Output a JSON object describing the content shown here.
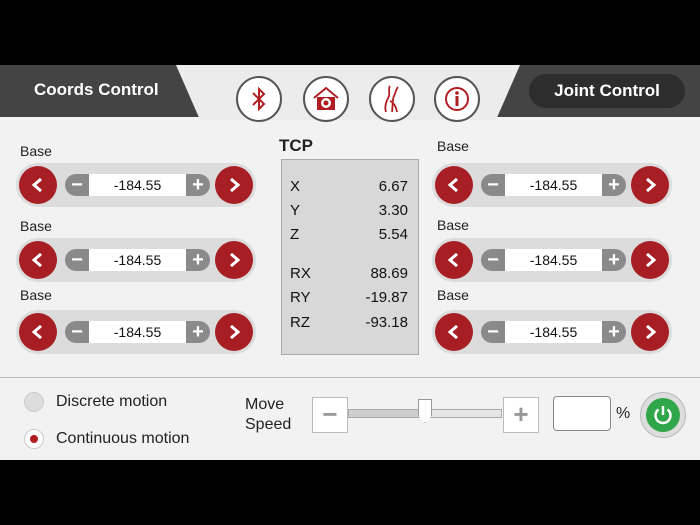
{
  "header": {
    "left_title": "Coords Control",
    "right_button": "Joint Control",
    "icons": [
      "bluetooth-icon",
      "home-target-icon",
      "hand-icon",
      "info-icon"
    ]
  },
  "left_controls": [
    {
      "label": "Base",
      "value": "-184.55"
    },
    {
      "label": "Base",
      "value": "-184.55"
    },
    {
      "label": "Base",
      "value": "-184.55"
    }
  ],
  "right_controls": [
    {
      "label": "Base",
      "value": "-184.55"
    },
    {
      "label": "Base",
      "value": "-184.55"
    },
    {
      "label": "Base",
      "value": "-184.55"
    }
  ],
  "tcp": {
    "title": "TCP",
    "rows": [
      {
        "key": "X",
        "value": "6.67"
      },
      {
        "key": "Y",
        "value": "3.30"
      },
      {
        "key": "Z",
        "value": "5.54"
      },
      {
        "key": "RX",
        "value": "88.69"
      },
      {
        "key": "RY",
        "value": "-19.87"
      },
      {
        "key": "RZ",
        "value": "-93.18"
      }
    ]
  },
  "motion": {
    "options": [
      {
        "label": "Discrete motion",
        "selected": false
      },
      {
        "label": "Continuous motion",
        "selected": true
      }
    ]
  },
  "speed": {
    "label_line1": "Move",
    "label_line2": "Speed",
    "minus": "−",
    "plus": "+",
    "slider_fraction": 0.5,
    "percent_value": "",
    "percent_sign": "%"
  },
  "colors": {
    "accent_red": "#a71f24",
    "power_green": "#2fa64a",
    "header_dark": "#444444"
  }
}
